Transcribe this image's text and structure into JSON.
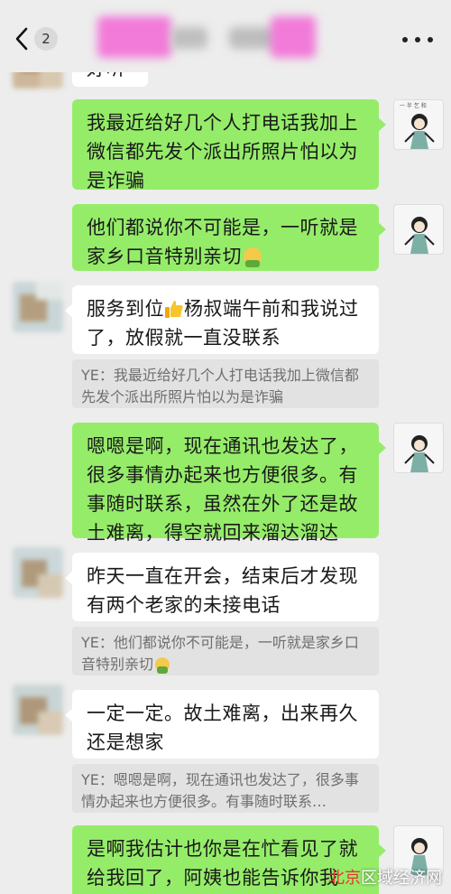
{
  "header": {
    "unread_count": "2",
    "title": ""
  },
  "messages": [
    {
      "id": "m0",
      "side": "left",
      "text": "好听"
    },
    {
      "id": "m1",
      "side": "right",
      "text": "我最近给好几个人打电话我加上微信都先发个派出所照片怕以为是诈骗"
    },
    {
      "id": "m2",
      "side": "right",
      "text": "他们都说你不可能是，一听就是家乡口音特别亲切"
    },
    {
      "id": "m3",
      "side": "left",
      "text_before": "服务到位",
      "text_after": "杨叔端午前和我说过了，放假就一直没联系",
      "quote": "YE：我最近给好几个人打电话我加上微信都先发个派出所照片怕以为是诈骗"
    },
    {
      "id": "m4",
      "side": "right",
      "text": "嗯嗯是啊，现在通讯也发达了，很多事情办起来也方便很多。有事随时联系，虽然在外了还是故土难离，得空就回来溜达溜达"
    },
    {
      "id": "m5",
      "side": "left",
      "text": "昨天一直在开会，结束后才发现有两个老家的未接电话",
      "quote": "YE：他们都说你不可能是，一听就是家乡口音特别亲切"
    },
    {
      "id": "m6",
      "side": "left",
      "text": "一定一定。故土难离，出来再久还是想家",
      "quote": "YE：嗯嗯是啊，现在通讯也发达了，很多事情办起来也方便很多。有事随时联系…"
    },
    {
      "id": "m7",
      "side": "right",
      "text": "是啊我估计也你是在忙看见了就给我回了，阿姨也能告诉你我"
    }
  ],
  "avatar_caption": "一 半 乞 和",
  "watermark": {
    "part1": "北京",
    "part2": "区域经济网"
  },
  "colors": {
    "background": "#ededed",
    "self_bubble": "#95ec69",
    "other_bubble": "#ffffff",
    "quote_bg": "#e2e2e2"
  },
  "icons": [
    "back-chevron-icon",
    "more-dots-icon",
    "thumbs-up-icon",
    "emoji-face-icon"
  ]
}
